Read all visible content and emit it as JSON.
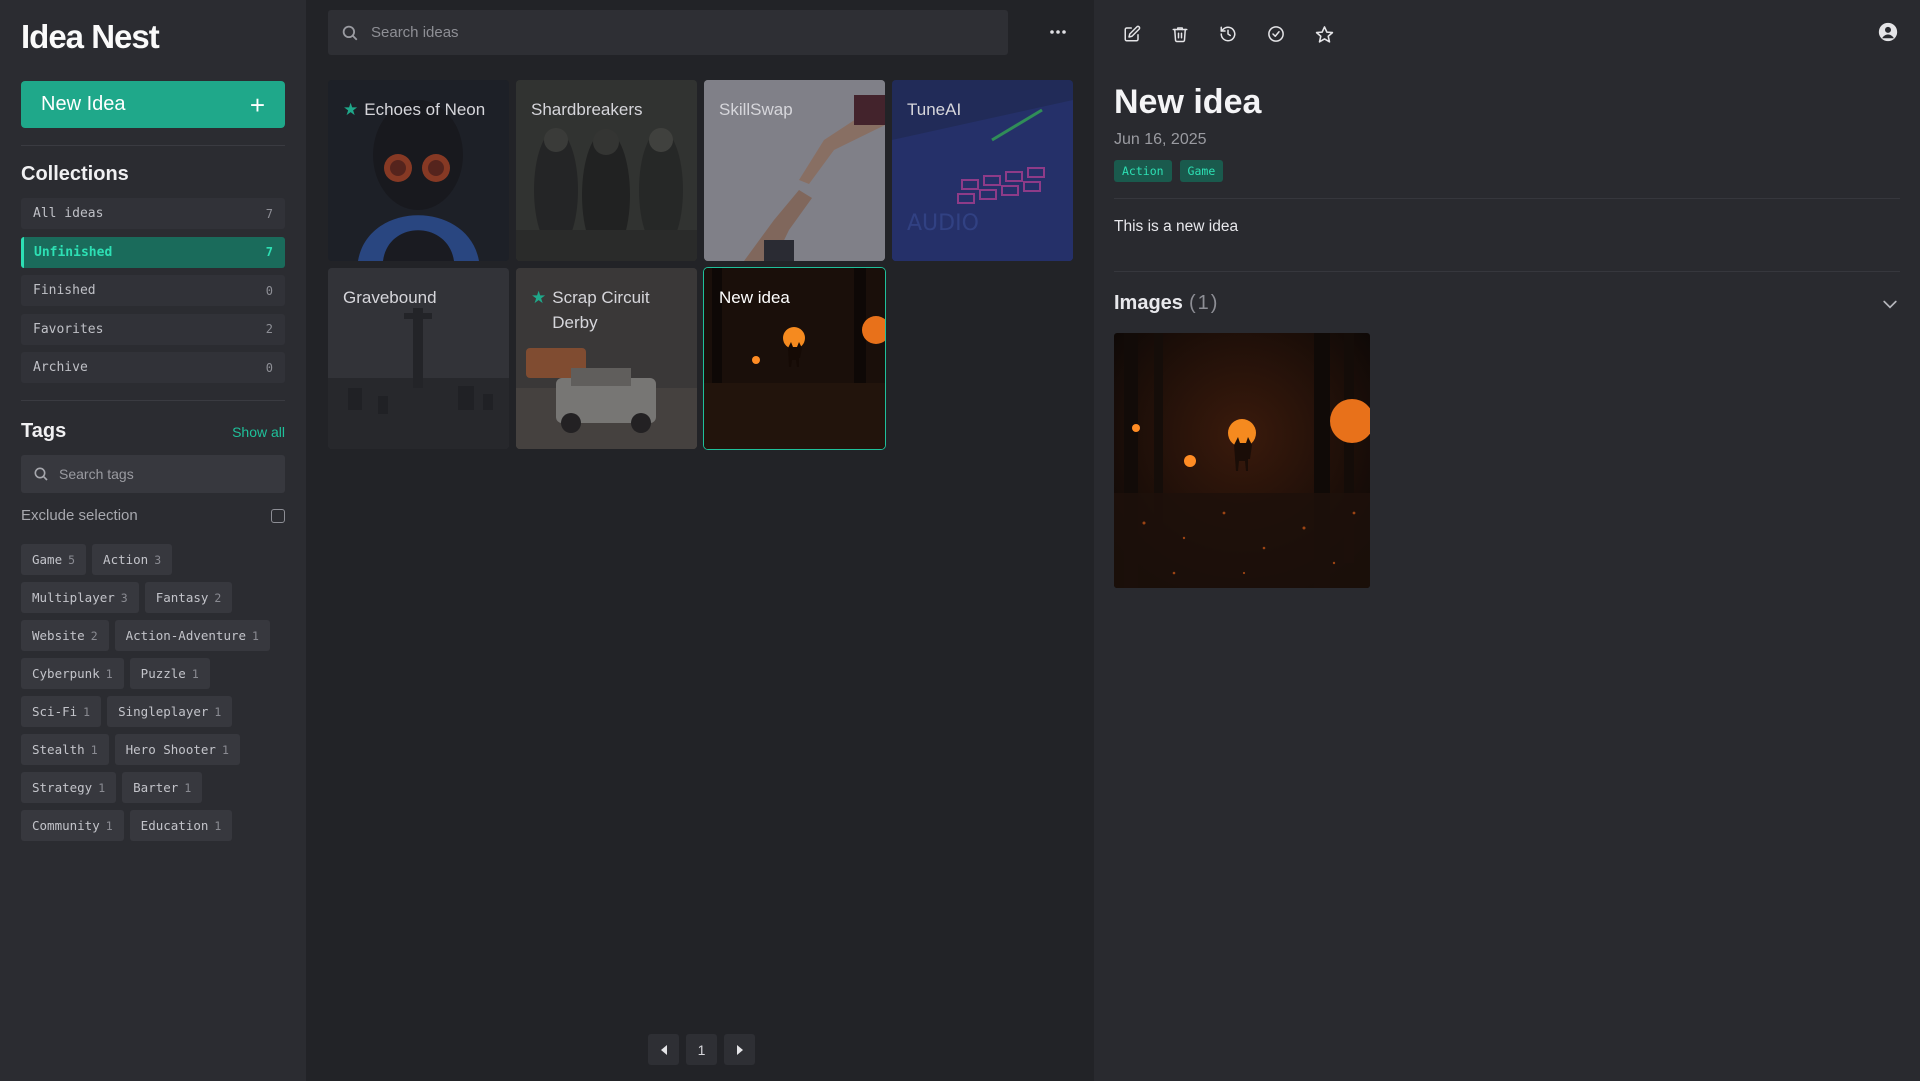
{
  "app": {
    "name": "Idea Nest",
    "accent": "#1fa88a"
  },
  "sidebar": {
    "new_idea_label": "New Idea",
    "new_idea_icon": "plus-icon",
    "collections_title": "Collections",
    "collections": [
      {
        "label": "All ideas",
        "count": "7"
      },
      {
        "label": "Unfinished",
        "count": "7",
        "active": true
      },
      {
        "label": "Finished",
        "count": "0"
      },
      {
        "label": "Favorites",
        "count": "2"
      },
      {
        "label": "Archive",
        "count": "0"
      }
    ],
    "tags_title": "Tags",
    "show_all_label": "Show all",
    "tag_search_placeholder": "Search tags",
    "exclude_label": "Exclude selection",
    "exclude_checked": false,
    "tags": [
      {
        "label": "Game",
        "count": "5"
      },
      {
        "label": "Action",
        "count": "3"
      },
      {
        "label": "Multiplayer",
        "count": "3"
      },
      {
        "label": "Fantasy",
        "count": "2"
      },
      {
        "label": "Website",
        "count": "2"
      },
      {
        "label": "Action-Adventure",
        "count": "1"
      },
      {
        "label": "Cyberpunk",
        "count": "1"
      },
      {
        "label": "Puzzle",
        "count": "1"
      },
      {
        "label": "Sci-Fi",
        "count": "1"
      },
      {
        "label": "Singleplayer",
        "count": "1"
      },
      {
        "label": "Stealth",
        "count": "1"
      },
      {
        "label": "Hero Shooter",
        "count": "1"
      },
      {
        "label": "Strategy",
        "count": "1"
      },
      {
        "label": "Barter",
        "count": "1"
      },
      {
        "label": "Community",
        "count": "1"
      },
      {
        "label": "Education",
        "count": "1"
      }
    ]
  },
  "main": {
    "search_placeholder": "Search ideas",
    "more_icon": "more-horizontal-icon",
    "cards": [
      {
        "title": "Echoes of Neon",
        "starred": true,
        "art": "neon"
      },
      {
        "title": "Shardbreakers",
        "starred": false,
        "art": "shard"
      },
      {
        "title": "SkillSwap",
        "starred": false,
        "art": "skill"
      },
      {
        "title": "TuneAI",
        "starred": false,
        "art": "tune"
      },
      {
        "title": "Gravebound",
        "starred": false,
        "art": "grave"
      },
      {
        "title": "Scrap Circuit Derby",
        "starred": true,
        "art": "derby"
      },
      {
        "title": "New idea",
        "starred": false,
        "art": "forest",
        "selected": true
      }
    ],
    "pagination": {
      "current": "1"
    }
  },
  "detail": {
    "title": "New idea",
    "date": "Jun 16, 2025",
    "tags": [
      "Action",
      "Game"
    ],
    "description": "This is a new idea",
    "images_label": "Images",
    "images_count": "(1)",
    "toolbar_icons": [
      "edit-icon",
      "trash-icon",
      "history-icon",
      "check-circle-icon",
      "star-icon"
    ]
  }
}
